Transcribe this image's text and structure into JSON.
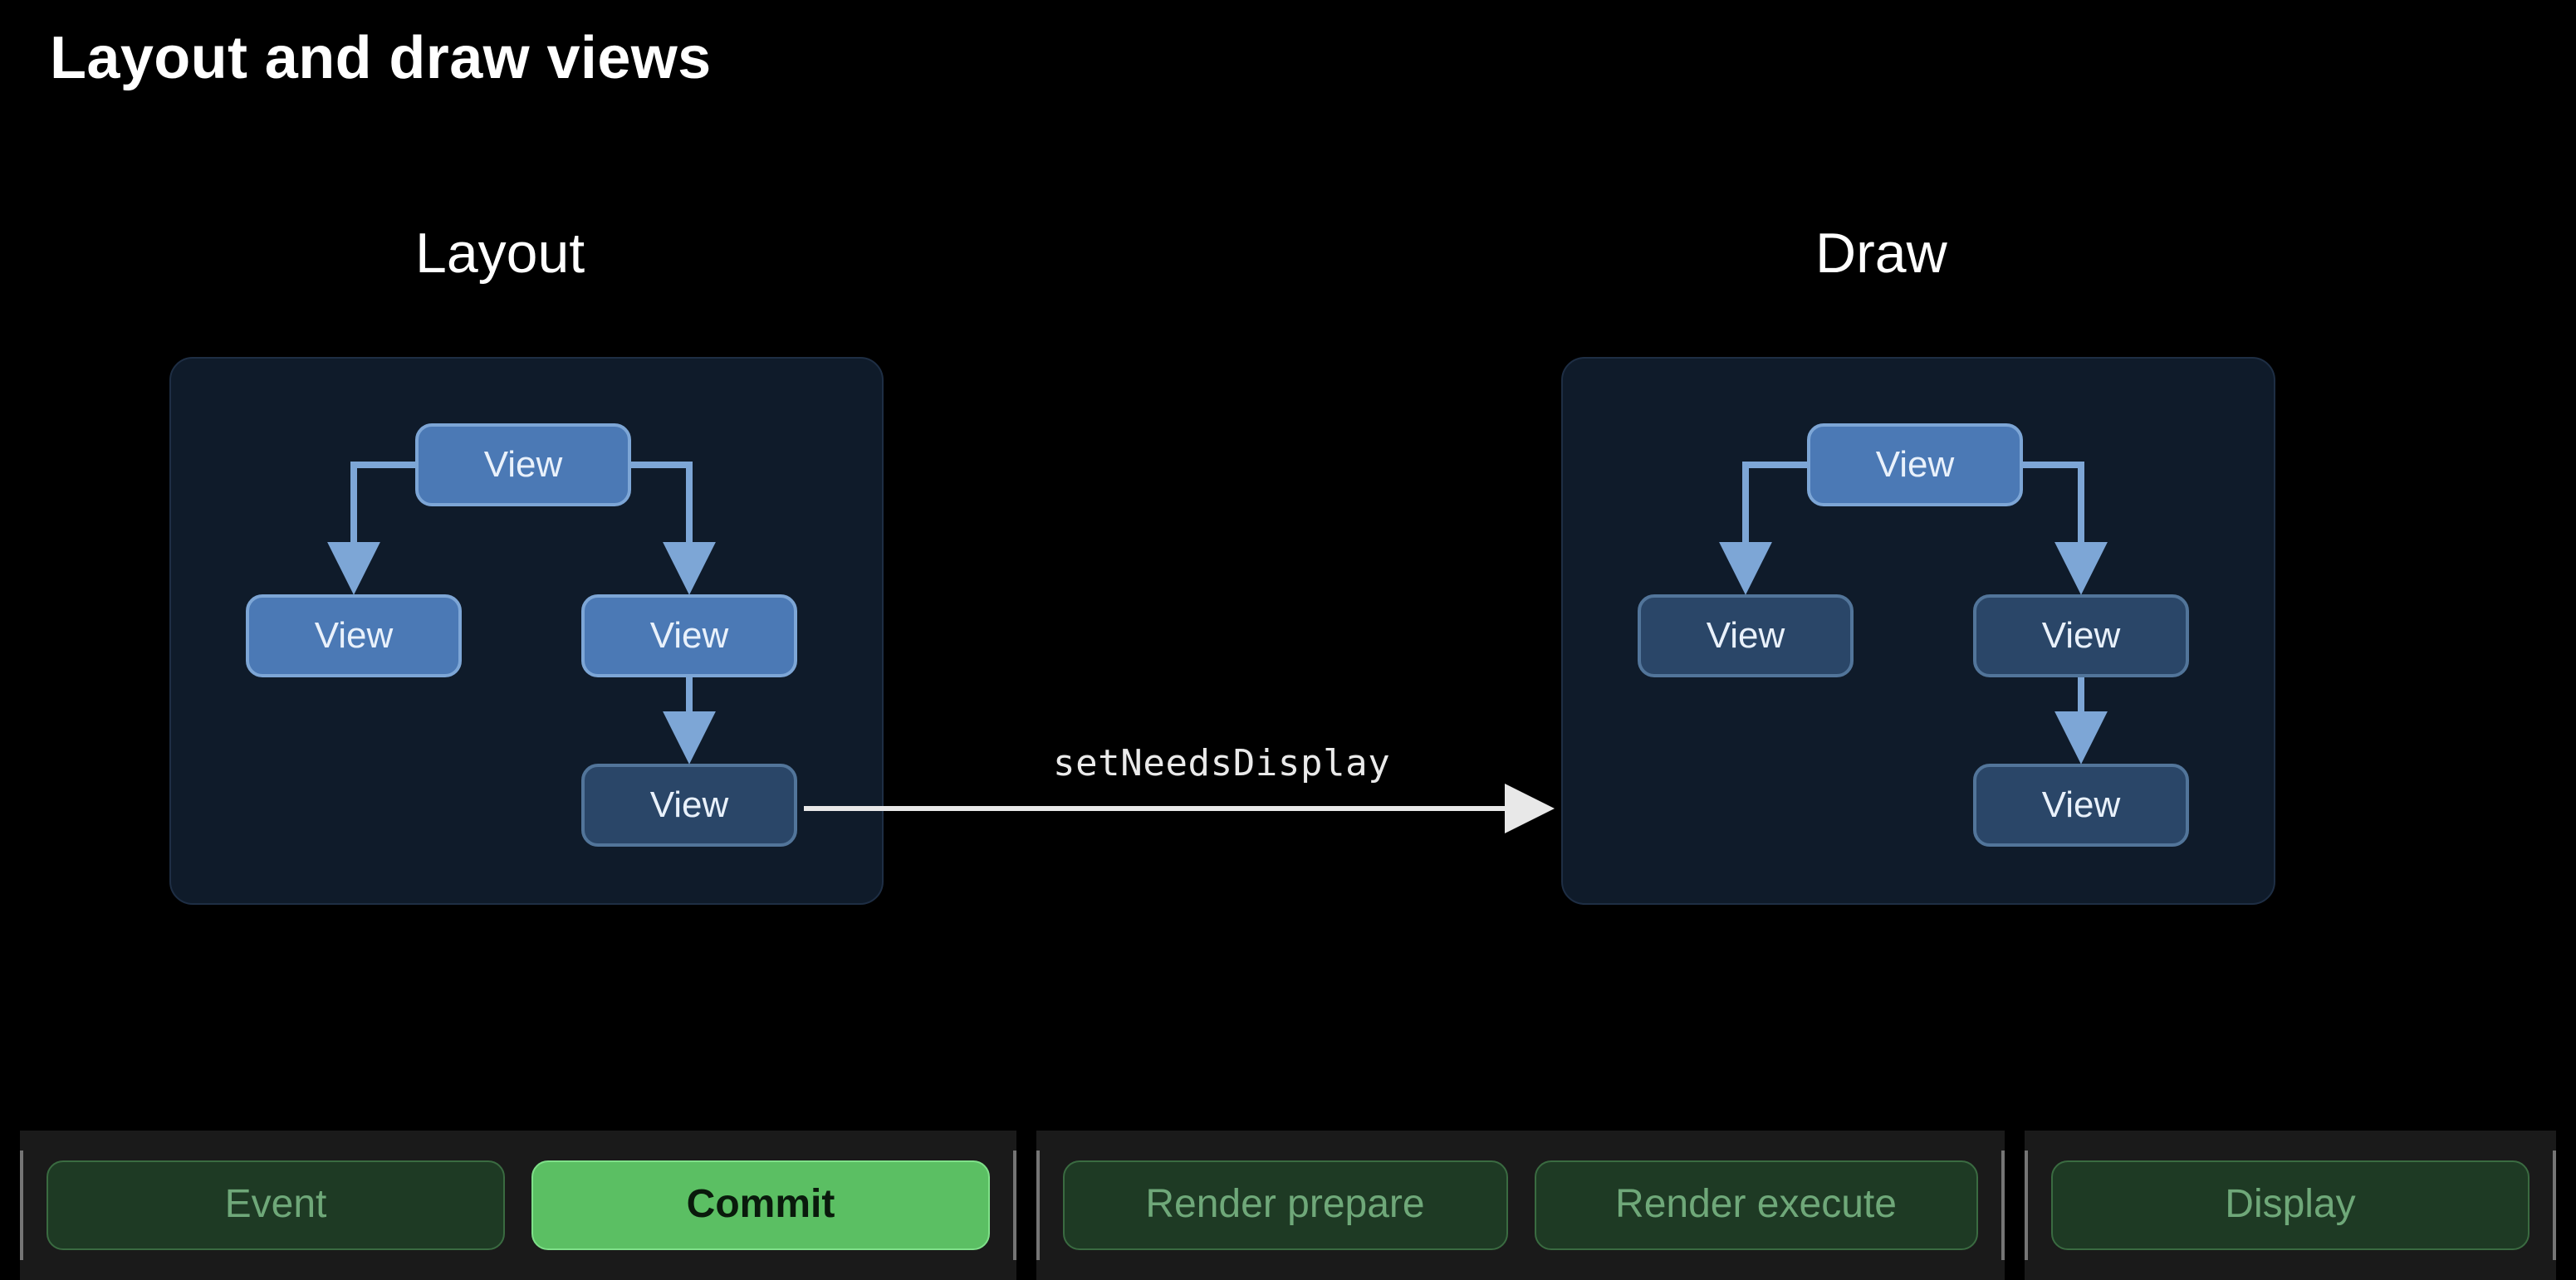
{
  "title": "Layout and draw views",
  "sections": {
    "layout_label": "Layout",
    "draw_label": "Draw"
  },
  "layout_tree": {
    "root": "View",
    "left": "View",
    "right": "View",
    "rightChild": "View"
  },
  "draw_tree": {
    "root": "View",
    "left": "View",
    "right": "View",
    "rightChild": "View"
  },
  "annotation": "setNeedsDisplay",
  "pipeline": {
    "group1": [
      {
        "label": "Event",
        "state": "dim"
      },
      {
        "label": "Commit",
        "state": "active"
      }
    ],
    "group2": [
      {
        "label": "Render prepare",
        "state": "dim"
      },
      {
        "label": "Render execute",
        "state": "dim"
      }
    ],
    "group3": [
      {
        "label": "Display",
        "state": "dim"
      }
    ]
  },
  "colors": {
    "node_bright": "#4b79b5",
    "node_dim": "#2a4668",
    "arrow_tree": "#7da6d6",
    "arrow_main": "#e8e8e8",
    "stage_active": "#5bbf63",
    "stage_dim": "#1e3a24"
  }
}
